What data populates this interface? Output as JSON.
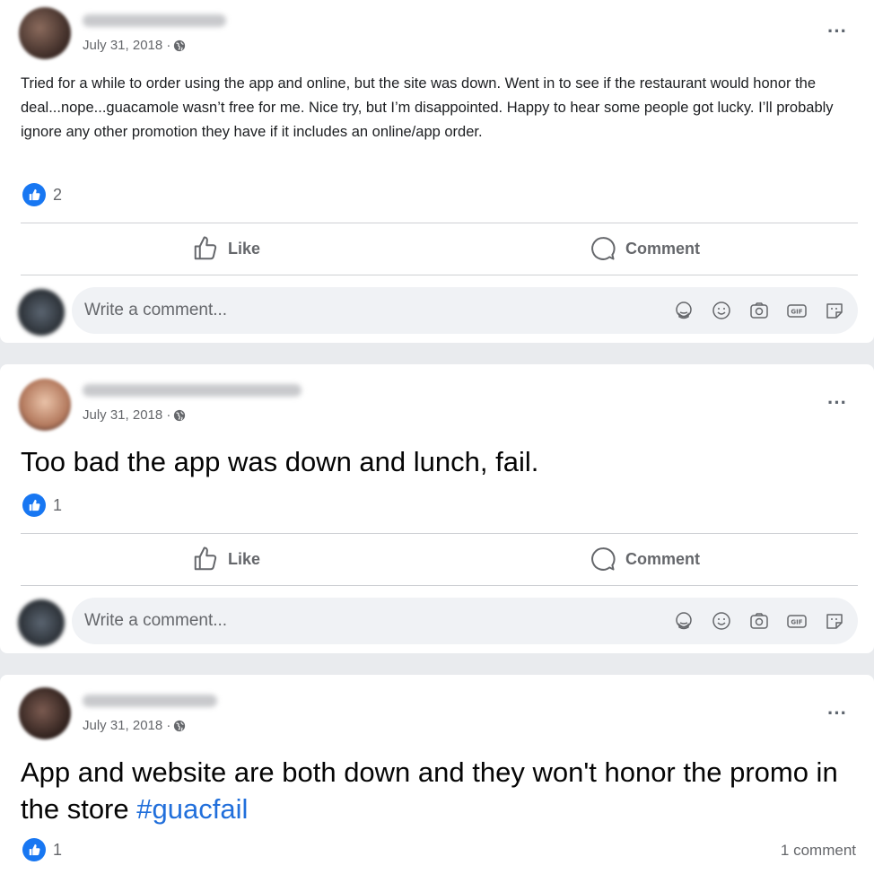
{
  "posts": [
    {
      "date": "July 31, 2018 ·",
      "text": "Tried for a while to order using the app and online, but the site was down. Went in to see if the restaurant would honor the deal...nope...guacamole wasn’t free for me. Nice try, but I’m disappointed. Happy to hear some people got lucky. I’ll probably ignore any other promotion they have if it includes an online/app order.",
      "like_count": "2",
      "actions": {
        "like": "Like",
        "comment": "Comment"
      },
      "comment_placeholder": "Write a comment..."
    },
    {
      "date": "July 31, 2018 ·",
      "text": "Too bad the app was down and lunch, fail.",
      "like_count": "1",
      "actions": {
        "like": "Like",
        "comment": "Comment"
      },
      "comment_placeholder": "Write a comment..."
    },
    {
      "date": "July 31, 2018 ·",
      "text": "App and website are both down and they won't honor the promo in the store ",
      "hashtag": "#guacfail",
      "like_count": "1",
      "comment_count": "1 comment"
    }
  ],
  "icons": [
    "globe-icon",
    "more-options-icon",
    "like-reaction-icon",
    "thumbs-up-icon",
    "comment-bubble-icon",
    "avatar-sticker-icon",
    "emoji-icon",
    "camera-icon",
    "gif-icon",
    "sticker-icon"
  ],
  "colors": {
    "like_blue": "#1877f2",
    "hashtag": "#216fdb",
    "muted_text": "#65676b",
    "comment_box": "#f0f2f5",
    "page_bg": "#e9ebee"
  }
}
